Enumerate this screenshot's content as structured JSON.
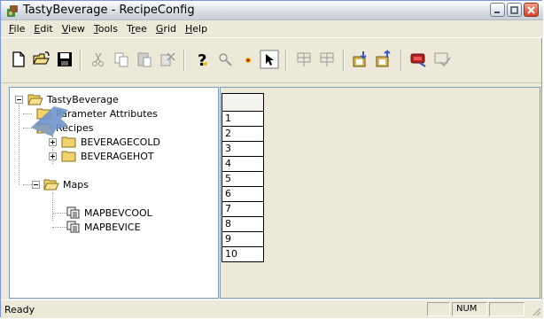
{
  "window": {
    "title": "TastyBeverage - RecipeConfig"
  },
  "menu": [
    {
      "pre": "",
      "ul": "F",
      "post": "ile"
    },
    {
      "pre": "",
      "ul": "E",
      "post": "dit"
    },
    {
      "pre": "",
      "ul": "V",
      "post": "iew"
    },
    {
      "pre": "",
      "ul": "T",
      "post": "ools"
    },
    {
      "pre": "T",
      "ul": "r",
      "post": "ee"
    },
    {
      "pre": "",
      "ul": "G",
      "post": "rid"
    },
    {
      "pre": "",
      "ul": "H",
      "post": "elp"
    }
  ],
  "toolbar": {
    "buttons": [
      "new-icon",
      "open-icon",
      "save-icon",
      "cut-icon",
      "copy-icon",
      "paste-icon",
      "delete-icon",
      "help-icon",
      "find-icon",
      "point-icon",
      "context-help-icon",
      "grid-row-icon",
      "grid-col-icon",
      "import-icon",
      "export-icon",
      "download-icon",
      "check-icon"
    ]
  },
  "tree": {
    "root": "TastyBeverage",
    "parameter_attributes": "Parameter Attributes",
    "recipes": "Recipes",
    "beverage_cold": "BEVERAGECOLD",
    "beverage_hot": "BEVERAGEHOT",
    "maps": "Maps",
    "map_cool": "MAPBEVCOOL",
    "map_ice": "MAPBEVICE"
  },
  "grid": {
    "row_numbers": [
      "1",
      "2",
      "3",
      "4",
      "5",
      "6",
      "7",
      "8",
      "9",
      "10"
    ]
  },
  "status": {
    "text": "Ready",
    "num": "NUM"
  }
}
